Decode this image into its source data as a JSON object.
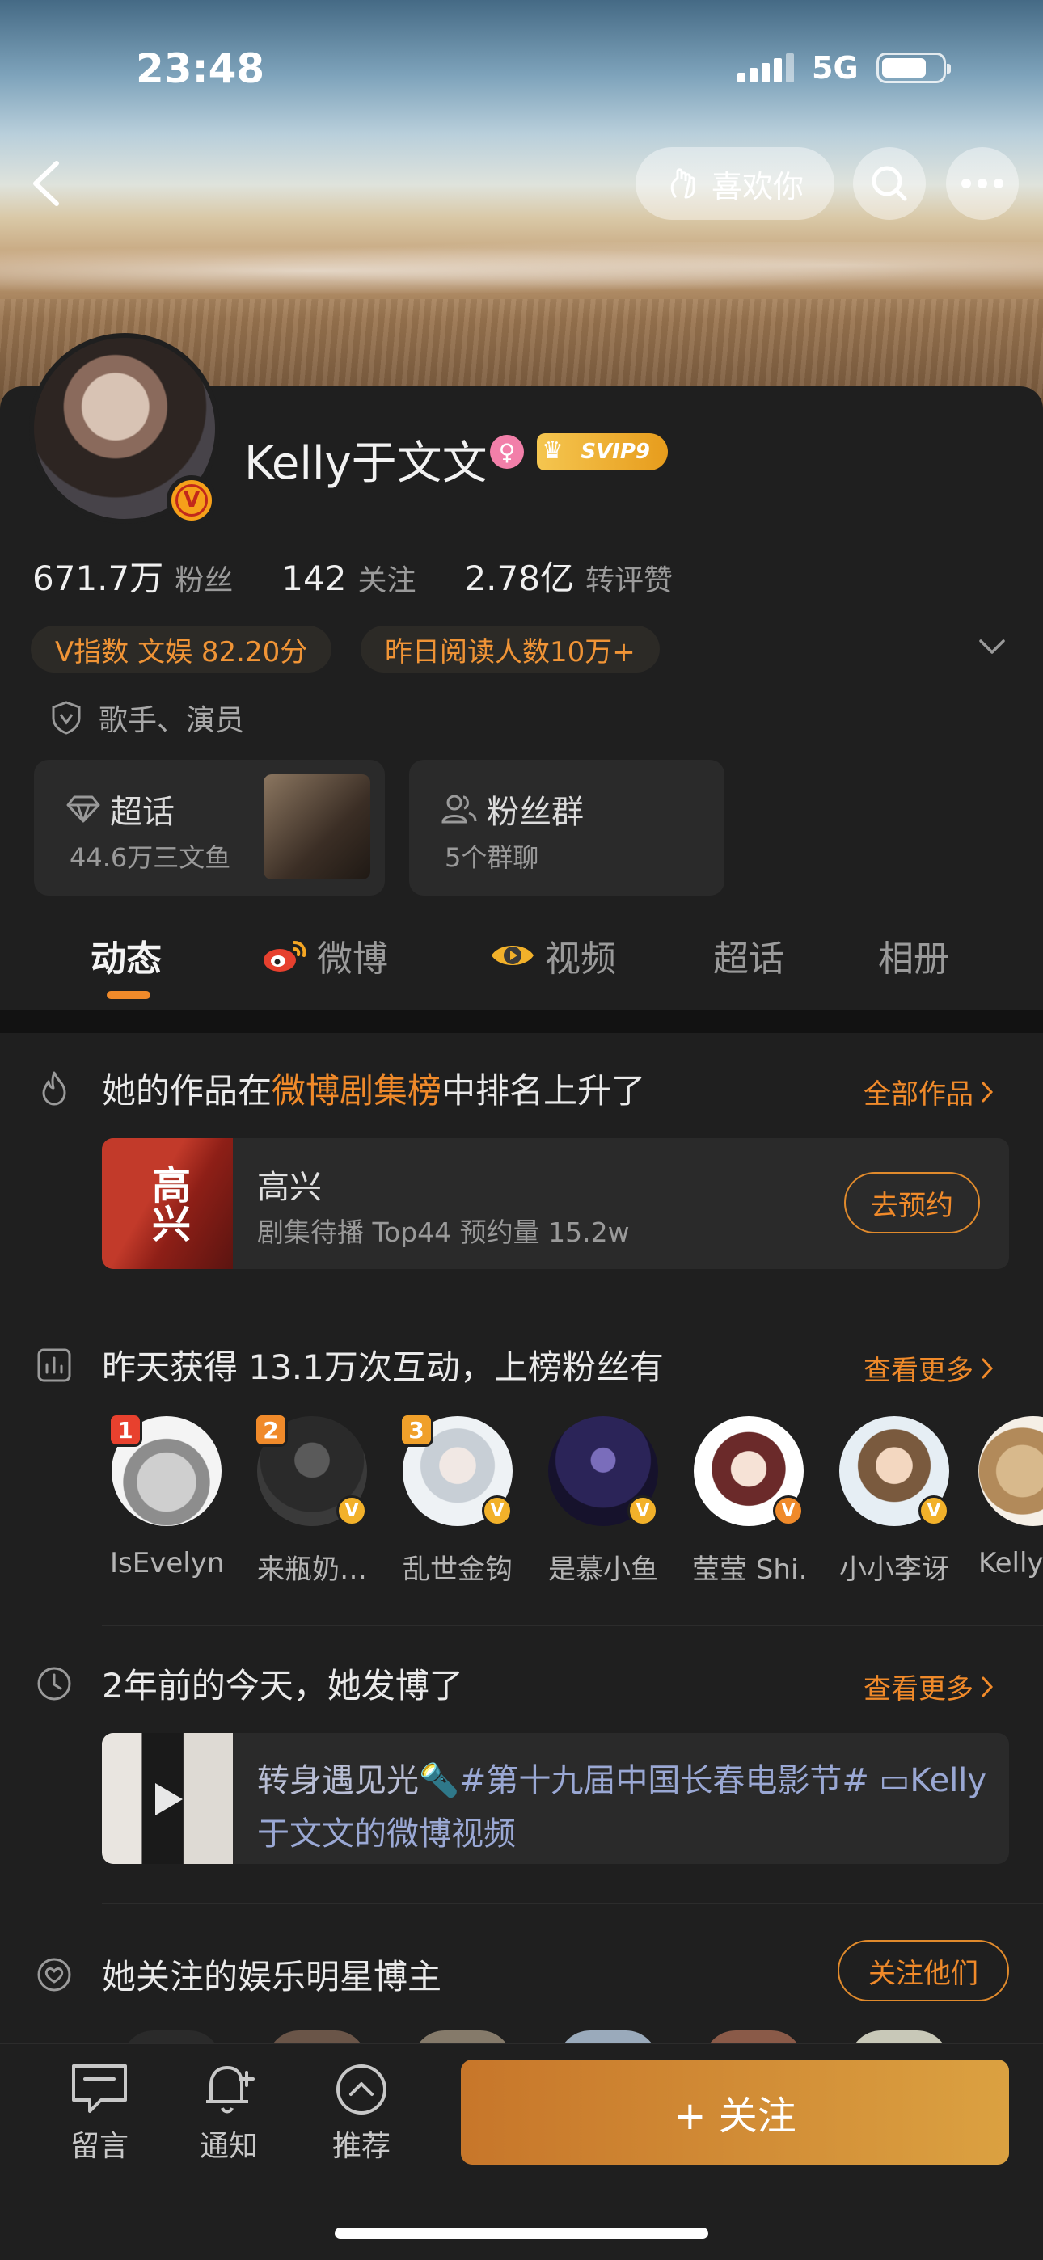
{
  "status_bar": {
    "time": "23:48",
    "network": "5G",
    "battery_level": 0.75
  },
  "header": {
    "like_label": "喜欢你",
    "icons": [
      "back-icon",
      "search-icon",
      "more-icon"
    ]
  },
  "profile": {
    "name": "Kelly于文文",
    "svip_label": "SVIP9",
    "stats": [
      {
        "value": "671.7万",
        "label": "粉丝"
      },
      {
        "value": "142",
        "label": "关注"
      },
      {
        "value": "2.78亿",
        "label": "转评赞"
      }
    ],
    "tags": [
      "V指数 文娱 82.20分",
      "昨日阅读人数10万+"
    ],
    "occupation": "歌手、演员",
    "boxes": [
      {
        "title": "超话",
        "subtitle": "44.6万三文鱼"
      },
      {
        "title": "粉丝群",
        "subtitle": "5个群聊"
      }
    ]
  },
  "tabs": [
    "动态",
    "微博",
    "视频",
    "超话",
    "相册"
  ],
  "sections": {
    "ranking": {
      "title_prefix": "她的作品在",
      "title_highlight": "微博剧集榜",
      "title_suffix": "中排名上升了",
      "more": "全部作品",
      "item_title": "高兴",
      "item_sub": "剧集待播 Top44 预约量 15.2w",
      "poster_text": "高兴",
      "button": "去预约"
    },
    "fans": {
      "title": "昨天获得 13.1万次互动，上榜粉丝有",
      "more": "查看更多",
      "list": [
        {
          "name": "IsEvelyn",
          "rank": "1"
        },
        {
          "name": "来瓶奶…",
          "rank": "2"
        },
        {
          "name": "乱世金钩",
          "rank": "3"
        },
        {
          "name": "是慕小鱼",
          "rank": ""
        },
        {
          "name": "莹莹 Shi…",
          "rank": ""
        },
        {
          "name": "小小李讶",
          "rank": ""
        },
        {
          "name": "Kelly",
          "rank": ""
        }
      ]
    },
    "memory": {
      "title": "2年前的今天，她发博了",
      "more": "查看更多",
      "text_plain": "转身遇见光🔦",
      "text_link": "#第十九届中国长春电影节# ▭Kelly于文文的微博视频"
    },
    "follows": {
      "title": "她关注的娱乐明星博主",
      "button": "关注他们"
    }
  },
  "bottom_bar": {
    "items": [
      "留言",
      "通知",
      "推荐"
    ],
    "follow_button": "+ 关注"
  },
  "colors": {
    "accent": "#f08a2a",
    "background": "#1f1f1f",
    "link": "#9aa8d4"
  }
}
